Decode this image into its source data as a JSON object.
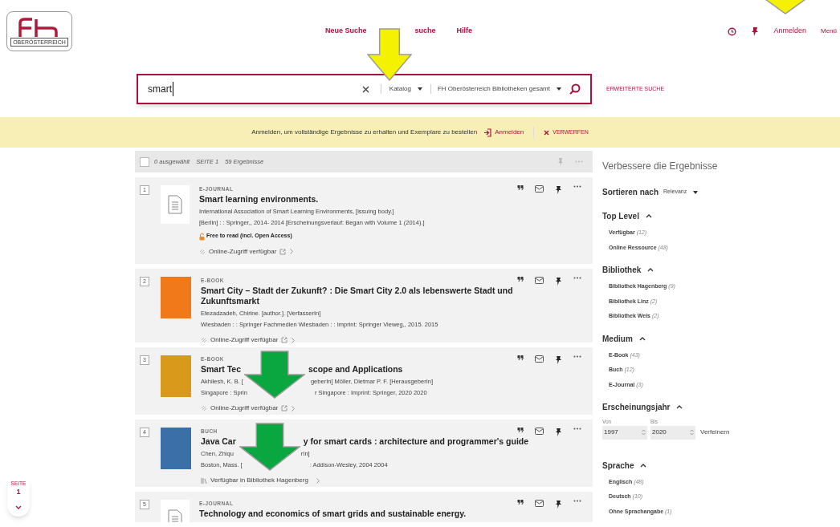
{
  "header": {
    "logo_text": "OBERÖSTERREICH",
    "nav": [
      "Neue Suche",
      "suche",
      "Hilfe"
    ],
    "login": "Anmelden",
    "menu": "Menü"
  },
  "search": {
    "value": "smart",
    "scope": "Katalog",
    "library": "FH Oberösterreich Bibliotheken gesamt",
    "advanced": "ERWEITERTE SUCHE"
  },
  "banner": {
    "message": "Anmelden, um vollständige Ergebnisse zu erhalten und Exemplare zu bestellen",
    "login": "Anmelden",
    "dismiss": "VERWERFEN"
  },
  "toolbar": {
    "checked": false,
    "selected": "0 ausgewählt",
    "page": "SEITE 1",
    "count": "59 Ergebnisse"
  },
  "results": [
    {
      "number": "1",
      "type": "E-JOURNAL",
      "thumb": {
        "kind": "document"
      },
      "title": [
        "Smart learning environments."
      ],
      "lines": [
        [
          "International Association of Smart Learning Environments, [issuing body.]"
        ],
        [
          "[Berlin] : : Springer,, 2014- 2014 [Erscheinungsverlauf: Began with Volume 1 (2014).]"
        ]
      ],
      "open_access": "Free to read (incl. Open Access)",
      "link": {
        "kind": "online",
        "text": "Online-Zugriff verfügbar"
      }
    },
    {
      "number": "2",
      "type": "E-BOOK",
      "thumb": {
        "kind": "cover",
        "color": "#f07a1a"
      },
      "title": [
        "Smart City – Stadt der Zukunft? : Die Smart City 2.0 als lebenswerte Stadt und Zukunftsmarkt"
      ],
      "lines": [
        [
          "Etezadzadeh, Chirine. [author.]. [VerfasserIn]"
        ],
        [
          "Wiesbaden : : Springer Fachmedien Wiesbaden : : Imprint: Springer Vieweg,, 2015. 2015"
        ]
      ],
      "link": {
        "kind": "online",
        "text": "Online-Zugriff verfügbar"
      }
    },
    {
      "number": "3",
      "type": "E-BOOK",
      "thumb": {
        "kind": "cover",
        "color": "#d99a1c"
      },
      "title": [
        "Smart Tec",
        "scope and Applications"
      ],
      "lines": [
        [
          "Akhilesh, K. B. [",
          "geberIn] Möller, Dietmar P. F. [HerausgeberIn]"
        ],
        [
          "Singapore : Sprin",
          "r Singapore : Imprint: Springer, 2020 2020"
        ]
      ],
      "link": {
        "kind": "online",
        "text": "Online-Zugriff verfügbar"
      }
    },
    {
      "number": "4",
      "type": "BUCH",
      "thumb": {
        "kind": "cover",
        "color": "#3a6fa8"
      },
      "title": [
        "Java Car",
        "y for smart cards : architecture and programmer's guide"
      ],
      "lines": [
        [
          "Chen, Zhiqu",
          "rIn]"
        ],
        [
          "Boston, Mass. [",
          ": Addison-Wesley, 2004 2004"
        ]
      ],
      "link": {
        "kind": "library",
        "text": "Verfügbar in Bibliothek Hagenberg"
      }
    },
    {
      "number": "5",
      "type": "E-JOURNAL",
      "thumb": {
        "kind": "document"
      },
      "title": [
        "Technology and economics of smart grids and sustainable energy."
      ]
    }
  ],
  "sidebar": {
    "title": "Verbessere die Ergebnisse",
    "sort_label": "Sortieren nach",
    "sort_value": "Relevanz",
    "facets": [
      {
        "kind": "list",
        "title": "Top Level",
        "items": [
          {
            "label": "Verfügbar",
            "count": "(12)"
          },
          {
            "label": "Online Ressource",
            "count": "(48)"
          }
        ]
      },
      {
        "kind": "list",
        "title": "Bibliothek",
        "items": [
          {
            "label": "Bibliothek Hagenberg",
            "count": "(9)"
          },
          {
            "label": "Bibliothek Linz",
            "count": "(2)"
          },
          {
            "label": "Bibliothek Wels",
            "count": "(2)"
          }
        ]
      },
      {
        "kind": "list",
        "title": "Medium",
        "items": [
          {
            "label": "E-Book",
            "count": "(43)"
          },
          {
            "label": "Buch",
            "count": "(12)"
          },
          {
            "label": "E-Journal",
            "count": "(3)"
          }
        ]
      },
      {
        "kind": "range",
        "title": "Erscheinungsjahr",
        "from_label": "Von",
        "from": "1997",
        "to_label": "Bis",
        "to": "2020",
        "button": "Verfeinern"
      },
      {
        "kind": "list",
        "title": "Sprache",
        "items": [
          {
            "label": "Englisch",
            "count": "(48)"
          },
          {
            "label": "Deutsch",
            "count": "(10)"
          },
          {
            "label": "Ohne Sprachangabe",
            "count": "(1)"
          }
        ]
      }
    ]
  },
  "page_indicator": {
    "label": "SEITE",
    "number": "1"
  },
  "annotation_arrows": [
    {
      "color": "#f5f200"
    },
    {
      "color": "#f5f200"
    },
    {
      "color": "#0aa640"
    },
    {
      "color": "#0aa640"
    }
  ]
}
